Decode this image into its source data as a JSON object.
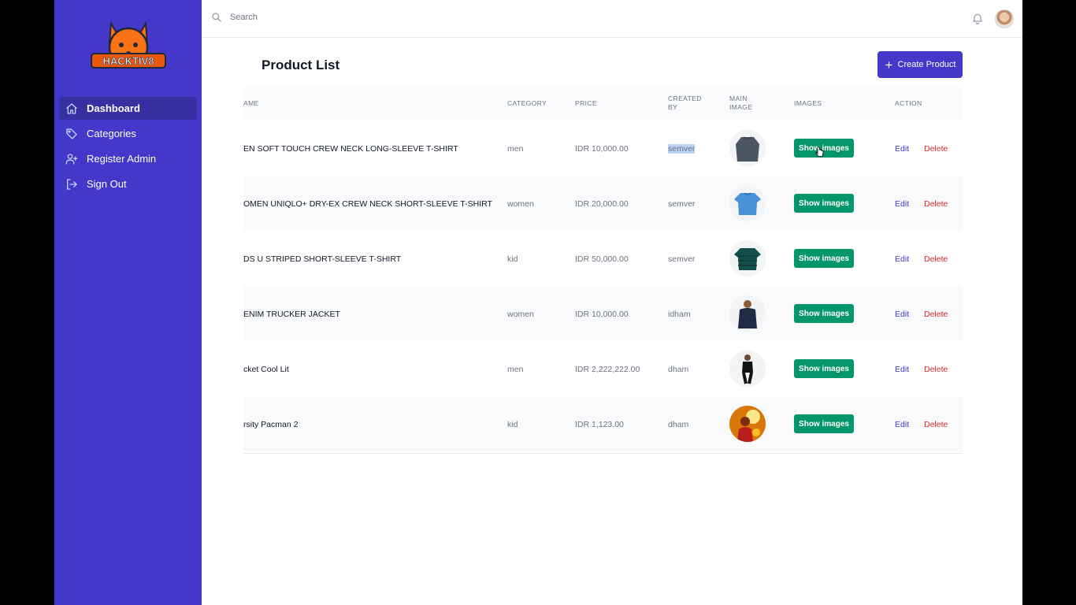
{
  "brand": {
    "logo_text": "HACKTIV8"
  },
  "sidebar": {
    "items": [
      {
        "label": "Dashboard",
        "icon": "home-icon",
        "active": true
      },
      {
        "label": "Categories",
        "icon": "tag-icon",
        "active": false
      },
      {
        "label": "Register Admin",
        "icon": "user-plus-icon",
        "active": false
      },
      {
        "label": "Sign Out",
        "icon": "sign-out-icon",
        "active": false
      }
    ]
  },
  "topbar": {
    "search_placeholder": "Search",
    "bell_icon": "bell-icon",
    "avatar_icon": "user-avatar"
  },
  "page": {
    "title": "Product List",
    "create_label": "Create Product"
  },
  "table": {
    "headers": {
      "name": "AME",
      "category": "CATEGORY",
      "price": "PRICE",
      "created_by": "CREATED BY",
      "main_image": "MAIN IMAGE",
      "images": "IMAGES",
      "action": "ACTION"
    },
    "rows": [
      {
        "name": "EN SOFT TOUCH CREW NECK LONG-SLEEVE T-SHIRT",
        "category": "men",
        "price": "IDR 10,000.00",
        "created_by": "semver",
        "show_label": "Show images",
        "edit_label": "Edit",
        "delete_label": "Delete"
      },
      {
        "name": "OMEN UNIQLO+ DRY-EX CREW NECK SHORT-SLEEVE T-SHIRT",
        "category": "women",
        "price": "IDR 20,000.00",
        "created_by": "semver",
        "show_label": "Show images",
        "edit_label": "Edit",
        "delete_label": "Delete"
      },
      {
        "name": "DS U STRIPED SHORT-SLEEVE T-SHIRT",
        "category": "kid",
        "price": "IDR 50,000.00",
        "created_by": "semver",
        "show_label": "Show images",
        "edit_label": "Edit",
        "delete_label": "Delete"
      },
      {
        "name": "ENIM TRUCKER JACKET",
        "category": "women",
        "price": "IDR 10,000.00",
        "created_by": "idham",
        "show_label": "Show images",
        "edit_label": "Edit",
        "delete_label": "Delete"
      },
      {
        "name": "cket Cool Lit",
        "category": "men",
        "price": "IDR 2,222,222.00",
        "created_by": "dham",
        "show_label": "Show images",
        "edit_label": "Edit",
        "delete_label": "Delete"
      },
      {
        "name": "rsity Pacman 2",
        "category": "kid",
        "price": "IDR 1,123.00",
        "created_by": "dham",
        "show_label": "Show images",
        "edit_label": "Edit",
        "delete_label": "Delete"
      }
    ]
  },
  "colors": {
    "sidebar": "#4338ca",
    "sidebar_active": "#3730a3",
    "accent": "#4338ca",
    "show_button": "#059669",
    "delete": "#dc2626"
  }
}
